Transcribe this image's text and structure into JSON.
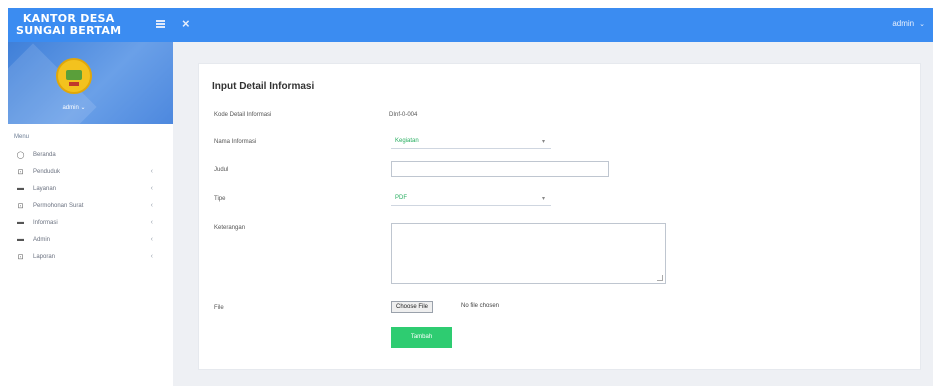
{
  "brand": {
    "line1": "KANTOR DESA",
    "line2": "SUNGAI BERTAM"
  },
  "topbar": {
    "close_icon": "×",
    "user": "admin",
    "user_chevron": "⌄"
  },
  "sidebar": {
    "profile_name": "admin ⌄",
    "menu_header": "Menu",
    "items": [
      {
        "label": "Beranda",
        "icon": "◯",
        "arrow": ""
      },
      {
        "label": "Penduduk",
        "icon": "⊡",
        "arrow": "‹"
      },
      {
        "label": "Layanan",
        "icon": "▬",
        "arrow": "‹"
      },
      {
        "label": "Permohonan Surat",
        "icon": "⊡",
        "arrow": "‹"
      },
      {
        "label": "Informasi",
        "icon": "▬",
        "arrow": "‹"
      },
      {
        "label": "Admin",
        "icon": "▬",
        "arrow": "‹"
      },
      {
        "label": "Laporan",
        "icon": "⊡",
        "arrow": "‹"
      }
    ]
  },
  "form": {
    "title": "Input Detail Informasi",
    "kode_label": "Kode Detail Informasi",
    "kode_value": "DInf-0-004",
    "nama_label": "Nama Informasi",
    "nama_value": "Kegiatan",
    "judul_label": "Judul",
    "judul_value": "",
    "tipe_label": "Tipe",
    "tipe_value": "PDF",
    "keterangan_label": "Keterangan",
    "keterangan_value": "",
    "file_label": "File",
    "file_button": "Choose File",
    "file_status": "No file chosen",
    "submit_label": "Tambah"
  },
  "colors": {
    "topbar": "#3b8cf1",
    "submit": "#2ecc71",
    "select_text": "#27ae60"
  }
}
